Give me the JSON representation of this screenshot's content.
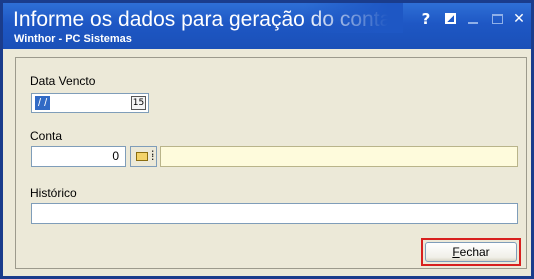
{
  "window": {
    "title": "Informe os dados para geração do conta",
    "subtitle": "Winthor - PC Sistemas",
    "buttons": {
      "help": "?",
      "close": "✕"
    }
  },
  "form": {
    "data_vencto": {
      "label": "Data Vencto",
      "value": " /  /",
      "calendar_icon": "15"
    },
    "conta": {
      "label": "Conta",
      "value": "0",
      "description": ""
    },
    "historico": {
      "label": "Histórico",
      "value": ""
    }
  },
  "actions": {
    "fechar_accel": "F",
    "fechar_rest": "echar"
  },
  "colors": {
    "titlebar": "#1e57c4",
    "highlight_outline": "#d8201e",
    "readonly_field": "#fefbdc"
  },
  "icons": [
    "calendar-icon",
    "folder-search-icon",
    "help-icon",
    "restore-icon",
    "minimize-icon",
    "maximize-icon",
    "close-icon"
  ]
}
